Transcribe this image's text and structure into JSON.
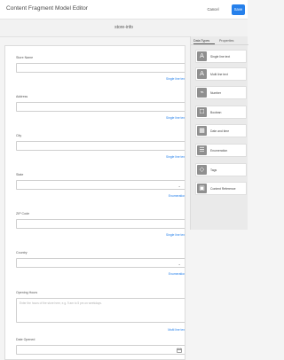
{
  "app": {
    "title": "Content Fragment Model Editor",
    "cancel_label": "Cancel",
    "save_label": "Save",
    "model_name": "store-info"
  },
  "fields": [
    {
      "label": "Store Name",
      "type": "Single line text"
    },
    {
      "label": "Address",
      "type": "Single line text"
    },
    {
      "label": "City",
      "type": "Single line text"
    },
    {
      "label": "State",
      "type": "Enumeration"
    },
    {
      "label": "ZIP Code",
      "type": "Single line text"
    },
    {
      "label": "Country",
      "type": "Enumeration"
    },
    {
      "label": "Opening Hours",
      "type": "Multi line text",
      "placeholder": "Enter the hours of the store here, e.g. 9 am to 5 pm on weekdays."
    },
    {
      "label": "Date Opened",
      "type": ""
    }
  ],
  "panel": {
    "tabs": [
      "Data Types",
      "Properties"
    ],
    "items": [
      {
        "label": "Single line text",
        "icon": "text-single-icon"
      },
      {
        "label": "Multi line text",
        "icon": "text-multi-icon"
      },
      {
        "label": "Number",
        "icon": "number-icon"
      },
      {
        "label": "Boolean",
        "icon": "boolean-icon"
      },
      {
        "label": "Date and time",
        "icon": "calendar-icon"
      },
      {
        "label": "Enumeration",
        "icon": "enumeration-icon"
      },
      {
        "label": "Tags",
        "icon": "tag-icon"
      },
      {
        "label": "Content Reference",
        "icon": "reference-icon"
      }
    ]
  }
}
